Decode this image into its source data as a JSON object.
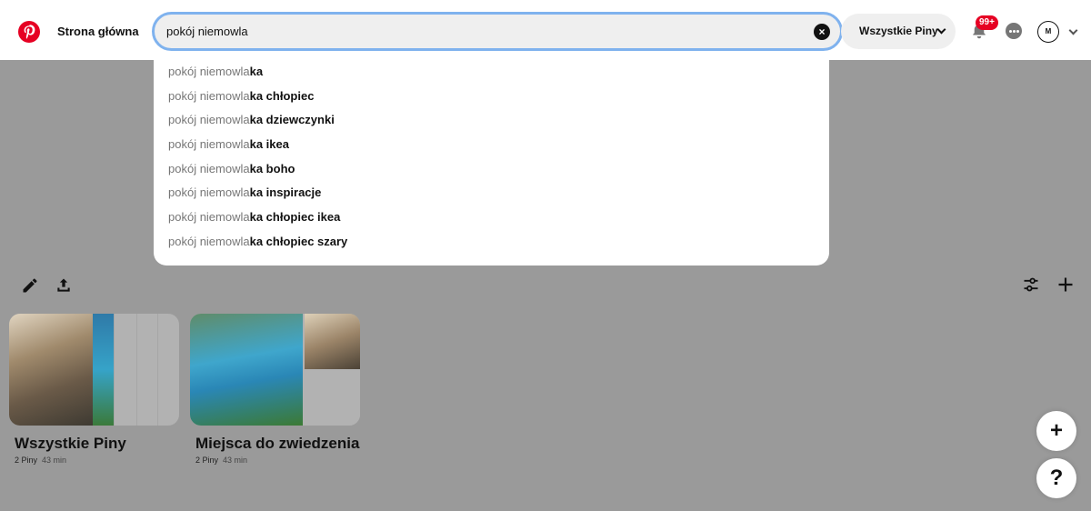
{
  "header": {
    "home_label": "Strona główna",
    "search_value": "pokój niemowla",
    "scope_label": "Wszystkie Piny",
    "notifications_badge": "99+",
    "avatar_initial": "M"
  },
  "suggestions": [
    {
      "prefix": "pokój niemowla",
      "completion": "ka"
    },
    {
      "prefix": "pokój niemowla",
      "completion": "ka chłopiec"
    },
    {
      "prefix": "pokój niemowla",
      "completion": "ka dziewczynki"
    },
    {
      "prefix": "pokój niemowla",
      "completion": "ka ikea"
    },
    {
      "prefix": "pokój niemowla",
      "completion": "ka boho"
    },
    {
      "prefix": "pokój niemowla",
      "completion": "ka inspiracje"
    },
    {
      "prefix": "pokój niemowla",
      "completion": "ka chłopiec ikea"
    },
    {
      "prefix": "pokój niemowla",
      "completion": "ka chłopiec szary"
    }
  ],
  "boards": [
    {
      "title": "Wszystkie Piny",
      "pins": "2 Piny",
      "updated": "43 min"
    },
    {
      "title": "Miejsca do zwiedzenia",
      "pins": "2 Piny",
      "updated": "43 min"
    }
  ],
  "icons": {
    "logo": "pinterest-logo",
    "edit": "pencil-icon",
    "share": "upload-icon",
    "filter": "sliders-icon",
    "add": "plus-icon",
    "help": "question-icon"
  },
  "colors": {
    "brand": "#e60023",
    "search_focus": "#7fb2ee"
  },
  "fab": {
    "add": "+",
    "help": "?"
  }
}
